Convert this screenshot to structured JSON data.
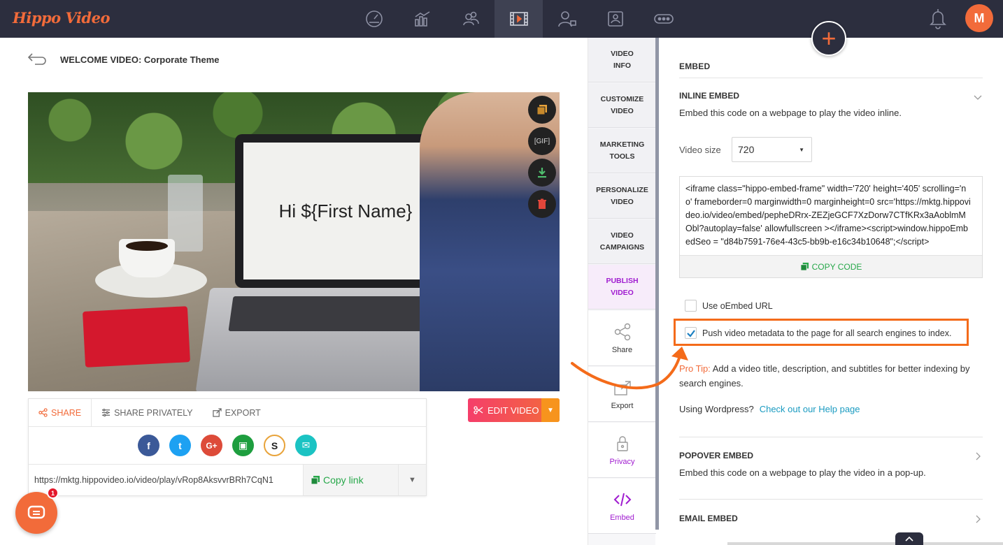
{
  "app": {
    "logo": "Hippo Video",
    "avatar_initial": "M"
  },
  "nav": {
    "icons": [
      "dashboard-icon",
      "analytics-icon",
      "contacts-icon",
      "videos-icon",
      "personalize-icon",
      "profile-icon",
      "more-icon"
    ],
    "active": "videos-icon"
  },
  "page": {
    "title": "WELCOME VIDEO: Corporate Theme"
  },
  "video": {
    "screen_text": "Hi ${First Name}"
  },
  "share": {
    "tabs": {
      "share": "SHARE",
      "share_privately": "SHARE PRIVATELY",
      "export": "EXPORT"
    },
    "link_url": "https://mktg.hippovideo.io/video/play/vRop8AksvvrBRh7CqN1",
    "copy_link": "Copy link",
    "social": [
      {
        "name": "facebook",
        "glyph": "f",
        "color": "#3b5998"
      },
      {
        "name": "twitter",
        "glyph": "t",
        "color": "#1da1f2"
      },
      {
        "name": "google-plus",
        "glyph": "G+",
        "color": "#dd4b39"
      },
      {
        "name": "google-classroom",
        "glyph": "▣",
        "color": "#1e9e3f"
      },
      {
        "name": "slack",
        "glyph": "S",
        "color": "#ffffff"
      },
      {
        "name": "email",
        "glyph": "✉",
        "color": "#1bc3c3"
      }
    ]
  },
  "edit_video": {
    "label": "EDIT VIDEO"
  },
  "chat": {
    "badge": "1"
  },
  "side_menu": {
    "video_info": [
      "VIDEO",
      "INFO"
    ],
    "customize_video": [
      "CUSTOMIZE",
      "VIDEO"
    ],
    "marketing_tools": [
      "MARKETING",
      "TOOLS"
    ],
    "personalize_video": [
      "PERSONALIZE",
      "VIDEO"
    ],
    "video_campaigns": [
      "VIDEO",
      "CAMPAIGNS"
    ],
    "publish_video": [
      "PUBLISH",
      "VIDEO"
    ],
    "share": "Share",
    "export": "Export",
    "privacy": "Privacy",
    "embed": "Embed"
  },
  "embed": {
    "title": "EMBED",
    "inline": {
      "title": "INLINE EMBED",
      "desc": "Embed this code on a webpage to play the video inline.",
      "video_size_label": "Video size",
      "video_size_value": "720",
      "code": "<iframe class=\"hippo-embed-frame\" width='720' height='405' scrolling='no' frameborder=0 marginwidth=0 marginheight=0 src='https://mktg.hippovideo.io/video/embed/pepheDRrx-ZEZjeGCF7XzDorw7CTfKRx3aAoblmMObl?autoplay=false' allowfullscreen ></iframe><script>window.hippoEmbedSeo = \"d84b7591-76e4-43c5-bb9b-e16c34b10648\";</script>",
      "copy_code": "COPY CODE",
      "use_oembed": "Use oEmbed URL",
      "push_metadata": "Push video metadata to the page for all search engines to index.",
      "pro_tip_label": "Pro Tip:",
      "pro_tip_text": " Add a video title, description, and subtitles for better indexing by search engines.",
      "wordpress_q": "Using Wordpress?",
      "help_link": "Check out our Help page"
    },
    "popover": {
      "title": "POPOVER EMBED",
      "desc": "Embed this code on a webpage to play the video in a pop-up."
    },
    "email": {
      "title": "EMAIL EMBED"
    }
  },
  "colors": {
    "accent": "#f26b3a",
    "nav_bg": "#2c2e3e",
    "green": "#27a84a",
    "purple": "#a01cd0",
    "highlight": "#f46b1a"
  }
}
